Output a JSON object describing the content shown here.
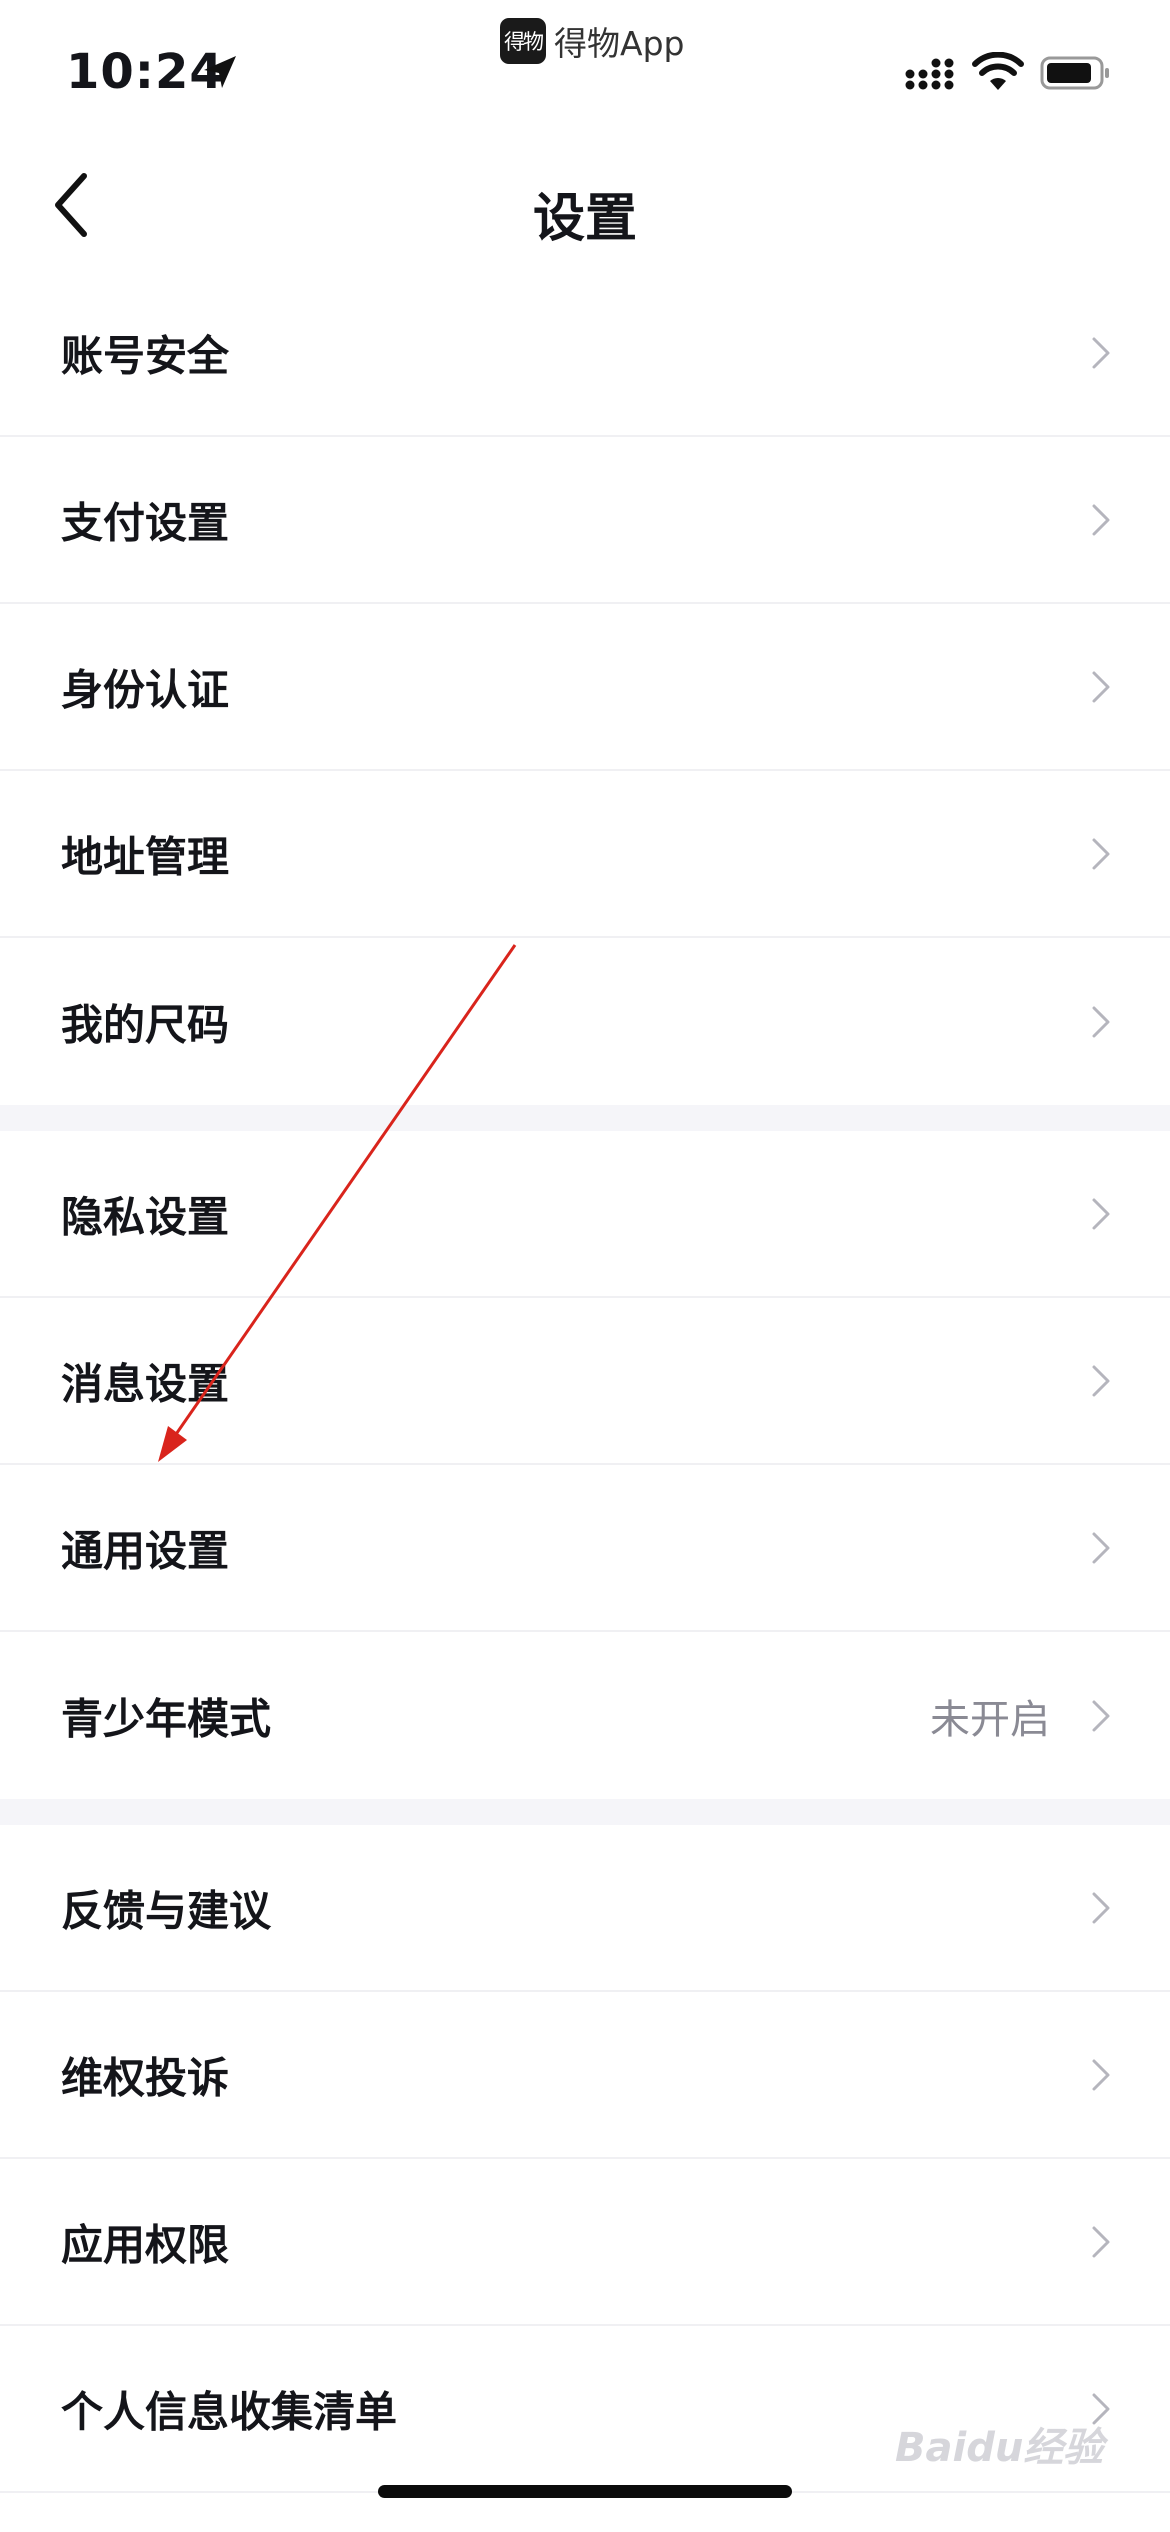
{
  "status_bar": {
    "time": "10:24",
    "app_logo_text": "得物",
    "app_name": "得物App"
  },
  "nav": {
    "title": "设置"
  },
  "settings": {
    "group1": [
      {
        "label": "账号安全"
      },
      {
        "label": "支付设置"
      },
      {
        "label": "身份认证"
      },
      {
        "label": "地址管理"
      },
      {
        "label": "我的尺码"
      }
    ],
    "group2": [
      {
        "label": "隐私设置"
      },
      {
        "label": "消息设置"
      },
      {
        "label": "通用设置"
      },
      {
        "label": "青少年模式",
        "value": "未开启"
      }
    ],
    "group3": [
      {
        "label": "反馈与建议"
      },
      {
        "label": "维权投诉"
      },
      {
        "label": "应用权限"
      },
      {
        "label": "个人信息收集清单"
      }
    ]
  },
  "annotation": {
    "arrow_color": "#d9241c"
  },
  "watermark": {
    "text": "Baidu经验"
  }
}
